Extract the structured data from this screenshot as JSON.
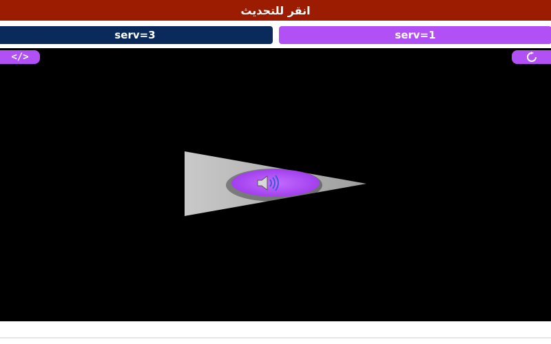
{
  "header": {
    "refresh_label": "انقر للتحديث"
  },
  "servers": {
    "left_label": "serv=3",
    "right_label": "serv=1"
  },
  "player": {
    "embed_label": "</>",
    "reload_icon": "reload-icon",
    "play_icon": "play-icon",
    "speaker_icon": "speaker-icon"
  },
  "colors": {
    "header_bg": "#9b1c00",
    "server_left_bg": "#0b2a5c",
    "accent_purple": "#b050f5",
    "player_bg": "#000000"
  }
}
